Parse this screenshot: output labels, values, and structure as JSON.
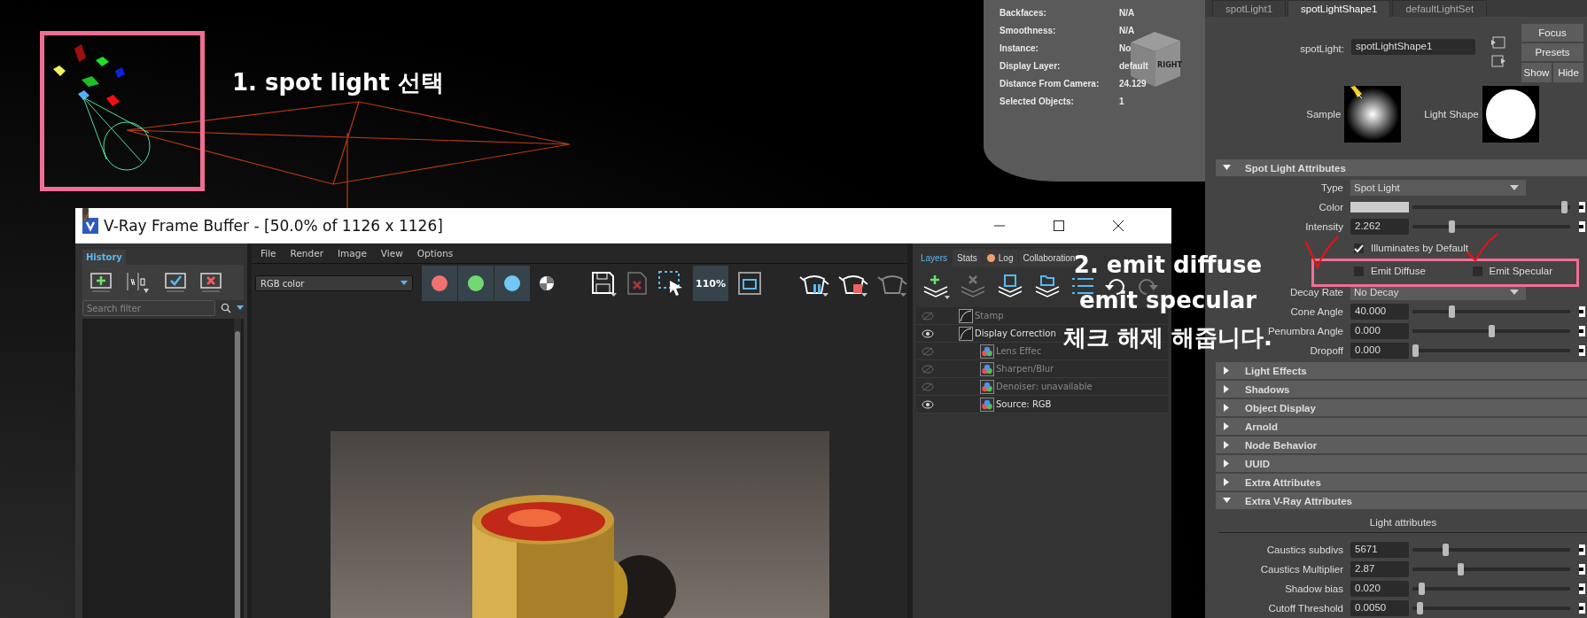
{
  "viewport": {
    "hud": [
      {
        "label": "Backfaces:",
        "value": "N/A"
      },
      {
        "label": "Smoothness:",
        "value": "N/A"
      },
      {
        "label": "Instance:",
        "value": "No"
      },
      {
        "label": "Display Layer:",
        "value": "default"
      },
      {
        "label": "Distance From Camera:",
        "value": "24.129"
      },
      {
        "label": "Selected Objects:",
        "value": "1"
      }
    ],
    "view_cube": {
      "label": "RIGHT"
    }
  },
  "annotations": {
    "step_1": "1. spot light  선택",
    "step_2": [
      "2. emit diffuse",
      "emit specular",
      "체크 해제 해줍니다."
    ]
  },
  "frame_buffer": {
    "title": "V-Ray Frame Buffer - [50.0% of 1126 x 1126]",
    "history": {
      "tab": "History",
      "search_placeholder": "Search filter",
      "thumbnails": [
        {
          "kind": "picture"
        },
        {
          "kind": "picture"
        },
        {
          "kind": "picture"
        },
        {
          "kind": "picture"
        }
      ]
    },
    "menu": [
      "File",
      "Render",
      "Image",
      "View",
      "Options"
    ],
    "channel_select": "RGB color",
    "channels": [
      {
        "color": "#f07272",
        "selected": true
      },
      {
        "color": "#72d872",
        "selected": true
      },
      {
        "color": "#72c8f5",
        "selected": true
      }
    ],
    "zoom_label": "110%",
    "render": {
      "kind": "picture"
    },
    "layer_tabs": [
      {
        "label": "Layers",
        "selected": true
      },
      {
        "label": "Stats",
        "selected": false
      },
      {
        "label": "Log",
        "selected": false,
        "color": "#f5a070"
      },
      {
        "label": "Collaboration",
        "selected": false
      }
    ],
    "layers": [
      {
        "label": "Stamp",
        "enabled": false
      },
      {
        "label": "Display Correction",
        "enabled": true,
        "children": [
          {
            "label": "Lens Effec",
            "enabled": false
          },
          {
            "label": "Sharpen/Blur",
            "enabled": false
          },
          {
            "label": "Denoiser: unavailable",
            "enabled": false
          },
          {
            "label": "Source: RGB",
            "enabled": true
          }
        ]
      }
    ]
  },
  "attribute_editor": {
    "tabs": [
      {
        "label": "spotLight1",
        "selected": false
      },
      {
        "label": "spotLightShape1",
        "selected": true
      },
      {
        "label": "defaultLightSet",
        "selected": false
      }
    ],
    "node_label": "spotLight:",
    "node_name": "spotLightShape1",
    "buttons": [
      "Focus",
      "Presets"
    ],
    "small_buttons": [
      "Show",
      "Hide"
    ],
    "swatches": [
      {
        "label": "Sample"
      },
      {
        "label": "Light Shape"
      }
    ],
    "sections": [
      {
        "title": "Spot Light Attributes",
        "expanded": true,
        "rows": [
          {
            "kind": "dropdown",
            "label": "Type",
            "value": "Spot Light"
          },
          {
            "kind": "color",
            "label": "Color",
            "color": "#cccccc",
            "level": 0.98
          },
          {
            "kind": "slider",
            "label": "Intensity",
            "value": "2.262",
            "level": 0.24
          },
          {
            "kind": "checkbox",
            "items": [
              {
                "label": "Illuminates by Default",
                "checked": true
              }
            ]
          },
          {
            "kind": "checkbox",
            "items": [
              {
                "label": "Emit Diffuse",
                "checked": false
              },
              {
                "label": "Emit Specular",
                "checked": false
              }
            ]
          },
          {
            "kind": "dropdown",
            "label": "Decay Rate",
            "value": "No Decay"
          },
          {
            "kind": "slider",
            "label": "Cone Angle",
            "value": "40.000",
            "level": 0.24
          },
          {
            "kind": "slider",
            "label": "Penumbra Angle",
            "value": "0.000",
            "level": 0.5
          },
          {
            "kind": "slider",
            "label": "Dropoff",
            "value": "0.000",
            "level": 0.0
          }
        ]
      },
      {
        "title": "Light Effects",
        "expanded": false
      },
      {
        "title": "Shadows",
        "expanded": false
      },
      {
        "title": "Object Display",
        "expanded": false
      },
      {
        "title": "Arnold",
        "expanded": false
      },
      {
        "title": "Node Behavior",
        "expanded": false
      },
      {
        "title": "UUID",
        "expanded": false
      },
      {
        "title": "Extra Attributes",
        "expanded": false
      },
      {
        "title": "Extra V-Ray Attributes",
        "expanded": true,
        "rows": [
          {
            "kind": "heading",
            "label": "Light attributes"
          },
          {
            "kind": "slider",
            "label": "Caustics subdivs",
            "value": "5671",
            "level": 0.2
          },
          {
            "kind": "slider",
            "label": "Caustics Multiplier",
            "value": "2.87",
            "level": 0.3
          },
          {
            "kind": "slider",
            "label": "Shadow bias",
            "value": "0.020",
            "level": 0.04
          },
          {
            "kind": "slider",
            "label": "Cutoff Threshold",
            "value": "0.0050",
            "level": 0.03
          }
        ]
      }
    ]
  }
}
